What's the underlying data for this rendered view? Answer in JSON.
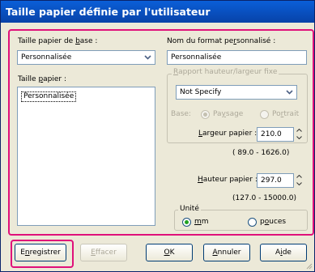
{
  "window": {
    "title": "Taille papier définie par l'utilisateur"
  },
  "left": {
    "base_size_label": "Taille papier de base :",
    "base_size_value": "Personnalisée",
    "paper_size_label": "Taille papier :",
    "paper_size_items": [
      "Personnalisée"
    ]
  },
  "right": {
    "custom_name_label": "Nom du format personnalisé :",
    "custom_name_value": "Personnalisée",
    "ratio_group_label": "Rapport hauteur/largeur fixe",
    "ratio_value": "Not Specify",
    "base_label": "Base:",
    "landscape_label": "Paysage",
    "portrait_label": "Portrait",
    "width_label": "Largeur papier :",
    "width_value": "210.0",
    "width_range": "( 89.0 - 1626.0)",
    "height_label": "Hauteur papier :",
    "height_value": "297.0",
    "height_range": "(127.0 - 15000.0)",
    "unit_group_label": "Unité",
    "unit_mm_label": "mm",
    "unit_inch_label": "pouces",
    "unit_selected": "mm"
  },
  "buttons": {
    "save": "Enregistrer",
    "delete": "Effacer",
    "ok": "OK",
    "cancel": "Annuler",
    "help": "Aide"
  },
  "colors": {
    "highlight": "#e0107a",
    "titlebar": "#0a5fd8",
    "radio_dot": "#21a121"
  }
}
